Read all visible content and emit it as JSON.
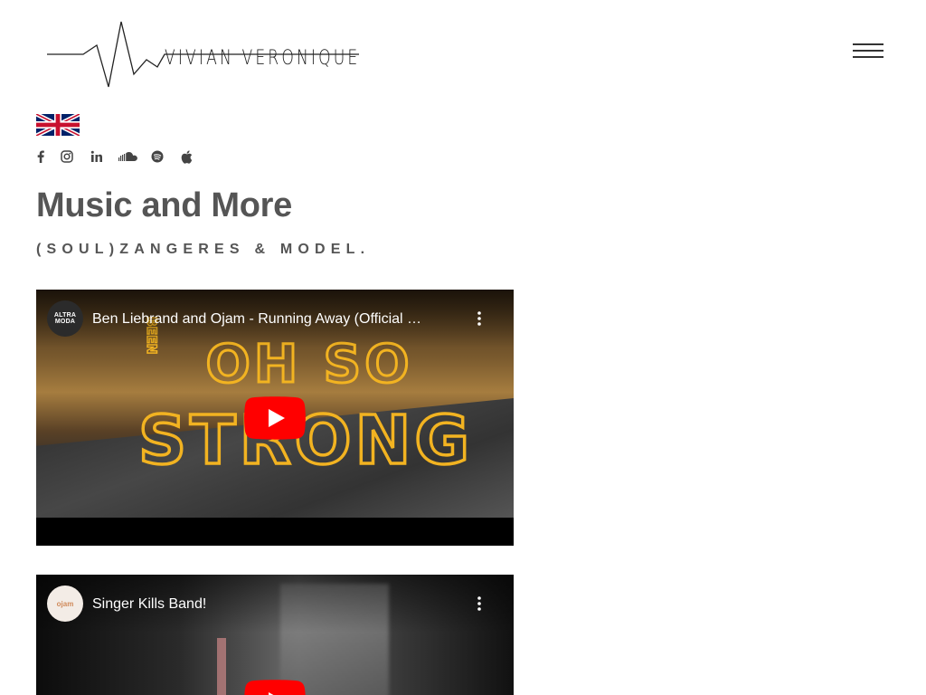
{
  "header": {
    "logo_text": "VIVIAN VERONIQUE",
    "menu_icon": "hamburger-menu-icon"
  },
  "language": {
    "flag": "uk-flag-icon"
  },
  "social": [
    {
      "name": "facebook",
      "icon": "facebook-icon",
      "glyph": "f"
    },
    {
      "name": "instagram",
      "icon": "instagram-icon",
      "glyph": "◎"
    },
    {
      "name": "linkedin",
      "icon": "linkedin-icon",
      "glyph": "in"
    },
    {
      "name": "soundcloud",
      "icon": "soundcloud-icon",
      "glyph": "☁"
    },
    {
      "name": "spotify",
      "icon": "spotify-icon",
      "glyph": "◉"
    },
    {
      "name": "apple",
      "icon": "apple-icon",
      "glyph": "●"
    }
  ],
  "main": {
    "title": "Music and More",
    "subtitle": "(SOUL)ZANGERES & MODEL."
  },
  "videos": [
    {
      "channel_avatar": "ALTRA MODA",
      "title": "Ben Liebrand and Ojam - Running Away (Official …",
      "thumbnail_text_small": "BEEN",
      "thumbnail_text_line1": "OH SO",
      "thumbnail_text_line2": "STRONG"
    },
    {
      "channel_avatar": "ojam",
      "title": "Singer Kills Band!"
    }
  ],
  "colors": {
    "heading": "#555555",
    "youtube_red": "#ff0000",
    "thumb_yellow": "#f2b321"
  }
}
